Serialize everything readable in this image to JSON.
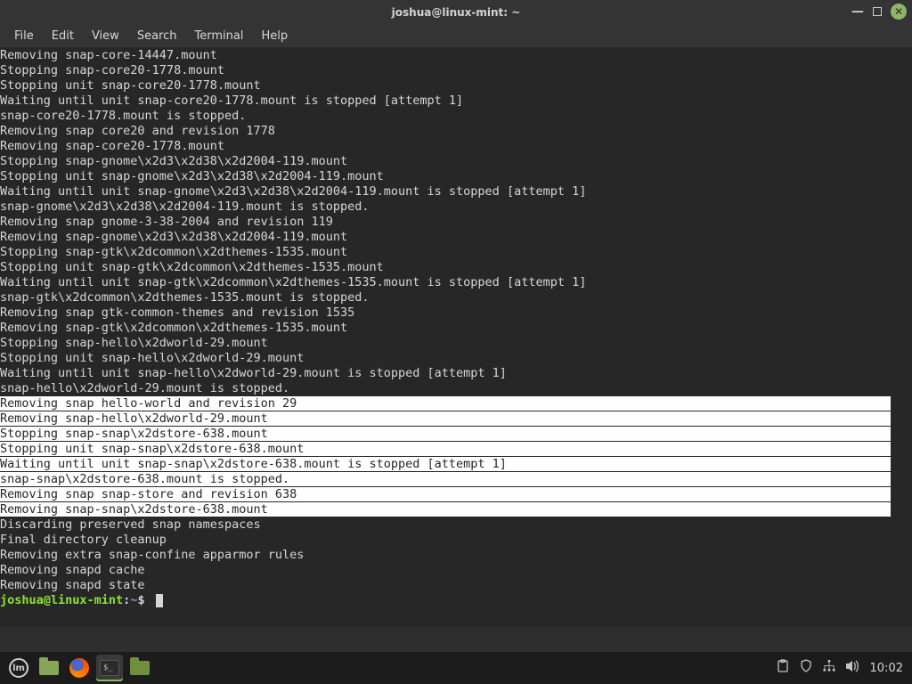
{
  "window": {
    "title": "joshua@linux-mint: ~"
  },
  "menu": {
    "items": [
      "File",
      "Edit",
      "View",
      "Search",
      "Terminal",
      "Help"
    ]
  },
  "terminal": {
    "lines_pre": [
      "Removing snap-core-14447.mount",
      "Stopping snap-core20-1778.mount",
      "Stopping unit snap-core20-1778.mount",
      "Waiting until unit snap-core20-1778.mount is stopped [attempt 1]",
      "snap-core20-1778.mount is stopped.",
      "Removing snap core20 and revision 1778",
      "Removing snap-core20-1778.mount",
      "Stopping snap-gnome\\x2d3\\x2d38\\x2d2004-119.mount",
      "Stopping unit snap-gnome\\x2d3\\x2d38\\x2d2004-119.mount",
      "Waiting until unit snap-gnome\\x2d3\\x2d38\\x2d2004-119.mount is stopped [attempt 1]",
      "snap-gnome\\x2d3\\x2d38\\x2d2004-119.mount is stopped.",
      "Removing snap gnome-3-38-2004 and revision 119",
      "Removing snap-gnome\\x2d3\\x2d38\\x2d2004-119.mount",
      "Stopping snap-gtk\\x2dcommon\\x2dthemes-1535.mount",
      "Stopping unit snap-gtk\\x2dcommon\\x2dthemes-1535.mount",
      "Waiting until unit snap-gtk\\x2dcommon\\x2dthemes-1535.mount is stopped [attempt 1]",
      "snap-gtk\\x2dcommon\\x2dthemes-1535.mount is stopped.",
      "Removing snap gtk-common-themes and revision 1535",
      "Removing snap-gtk\\x2dcommon\\x2dthemes-1535.mount",
      "Stopping snap-hello\\x2dworld-29.mount",
      "Stopping unit snap-hello\\x2dworld-29.mount",
      "Waiting until unit snap-hello\\x2dworld-29.mount is stopped [attempt 1]",
      "snap-hello\\x2dworld-29.mount is stopped."
    ],
    "lines_sel": [
      "Removing snap hello-world and revision 29",
      "Removing snap-hello\\x2dworld-29.mount",
      "Stopping snap-snap\\x2dstore-638.mount",
      "Stopping unit snap-snap\\x2dstore-638.mount",
      "Waiting until unit snap-snap\\x2dstore-638.mount is stopped [attempt 1]",
      "snap-snap\\x2dstore-638.mount is stopped.",
      "Removing snap snap-store and revision 638",
      "Removing snap-snap\\x2dstore-638.mount"
    ],
    "lines_post": [
      "Discarding preserved snap namespaces",
      "Final directory cleanup",
      "Removing extra snap-confine apparmor rules",
      "Removing snapd cache",
      "Removing snapd state"
    ],
    "prompt": {
      "user_host": "joshua@linux-mint",
      "colon": ":",
      "path": "~",
      "symbol": "$"
    }
  },
  "taskbar": {
    "clock": "10:02"
  }
}
